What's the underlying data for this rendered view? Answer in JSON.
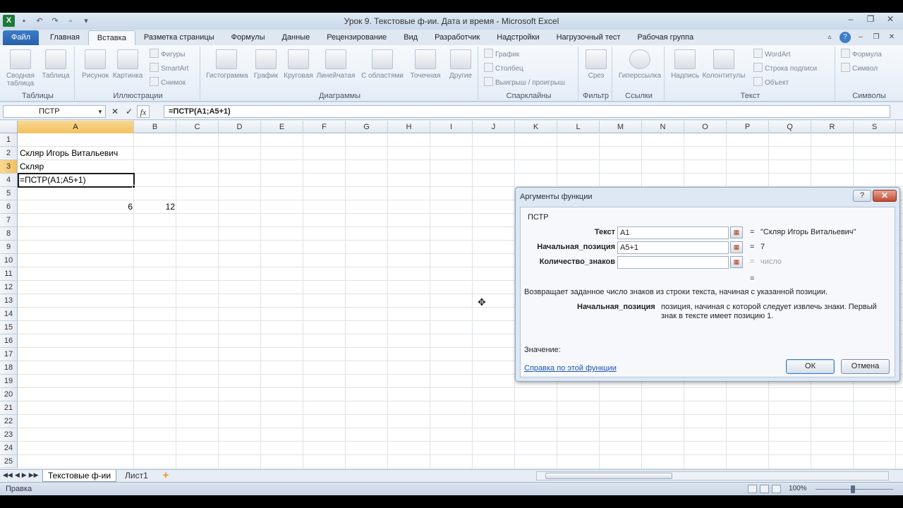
{
  "window": {
    "title": "Урок 9. Текстовые ф-ии. Дата и время - Microsoft Excel",
    "app_logo": "X",
    "qat_icons": [
      "save-icon",
      "undo-icon",
      "redo-icon",
      "new-file-icon",
      "customize-icon"
    ],
    "minimize": "‒",
    "restore": "❐",
    "close": "✕"
  },
  "ribbon": {
    "tabs": [
      "Файл",
      "Главная",
      "Вставка",
      "Разметка страницы",
      "Формулы",
      "Данные",
      "Рецензирование",
      "Вид",
      "Разработчик",
      "Надстройки",
      "Нагрузочный тест",
      "Рабочая группа"
    ],
    "active_tab": "Вставка",
    "groups": {
      "tables": {
        "label": "Таблицы",
        "pivot": "Сводная таблица",
        "table": "Таблица"
      },
      "illustrations": {
        "label": "Иллюстрации",
        "picture": "Рисунок",
        "clipart": "Картинка",
        "shapes": "Фигуры",
        "smartart": "SmartArt",
        "screenshot": "Снимок"
      },
      "charts": {
        "label": "Диаграммы",
        "column": "Гистограмма",
        "line": "График",
        "pie": "Круговая",
        "bar": "Линейчатая",
        "area": "С областями",
        "scatter": "Точечная",
        "other": "Другие"
      },
      "sparklines": {
        "label": "Спарклайны",
        "line": "График",
        "column": "Столбец",
        "winloss": "Выигрыш / проигрыш"
      },
      "filter": {
        "label": "Фильтр",
        "slicer": "Срез"
      },
      "links": {
        "label": "Ссылки",
        "hyperlink": "Гиперссылка"
      },
      "text": {
        "label": "Текст",
        "textbox": "Надпись",
        "headerfooter": "Колонтитулы",
        "wordart": "WordArt",
        "signature": "Строка подписи",
        "object": "Объект"
      },
      "symbols": {
        "label": "Символы",
        "equation": "Формула",
        "symbol": "Символ"
      }
    }
  },
  "formula_bar": {
    "name_box": "ПСТР",
    "cancel": "✕",
    "enter": "✓",
    "fx": "fx",
    "formula": "=ПСТР(A1;A5+1)"
  },
  "sheet": {
    "columns": [
      "A",
      "B",
      "C",
      "D",
      "E",
      "F",
      "G",
      "H",
      "I",
      "J",
      "K",
      "L",
      "M",
      "N",
      "O",
      "P",
      "Q",
      "R",
      "S"
    ],
    "selected_column": "A",
    "rows": [
      "1",
      "2",
      "3",
      "4",
      "5",
      "6",
      "7",
      "8",
      "9",
      "10",
      "11",
      "12",
      "13",
      "14",
      "15",
      "16",
      "17",
      "18",
      "19",
      "20",
      "21",
      "22",
      "23",
      "24",
      "25"
    ],
    "selected_row": "3",
    "cells": {
      "A1": "Скляр Игорь Витальевич",
      "A2": "Скляр",
      "A3": "=ПСТР(A1;A5+1)",
      "A5": "6",
      "B5": "12"
    }
  },
  "dialog": {
    "title": "Аргументы функции",
    "help": "?",
    "close": "✕",
    "function_name": "ПСТР",
    "args": [
      {
        "label": "Текст",
        "value": "A1",
        "result": "\"Скляр Игорь Витальевич\""
      },
      {
        "label": "Начальная_позиция",
        "value": "A5+1",
        "result": "7"
      },
      {
        "label": "Количество_знаков",
        "value": "",
        "result": "число"
      }
    ],
    "equals": "=",
    "description": "Возвращает заданное число знаков из строки текста, начиная с указанной позиции.",
    "arg_help_name": "Начальная_позиция",
    "arg_help_text": "позиция, начиная с которой следует извлечь знаки. Первый знак в тексте имеет позицию 1.",
    "value_label": "Значение:",
    "help_link": "Справка по этой функции",
    "ok": "ОК",
    "cancel": "Отмена"
  },
  "sheet_tabs": {
    "tabs": [
      "Текстовые ф-ии",
      "Лист1"
    ],
    "active": "Текстовые ф-ии"
  },
  "status": {
    "mode": "Правка",
    "zoom": "100%"
  }
}
